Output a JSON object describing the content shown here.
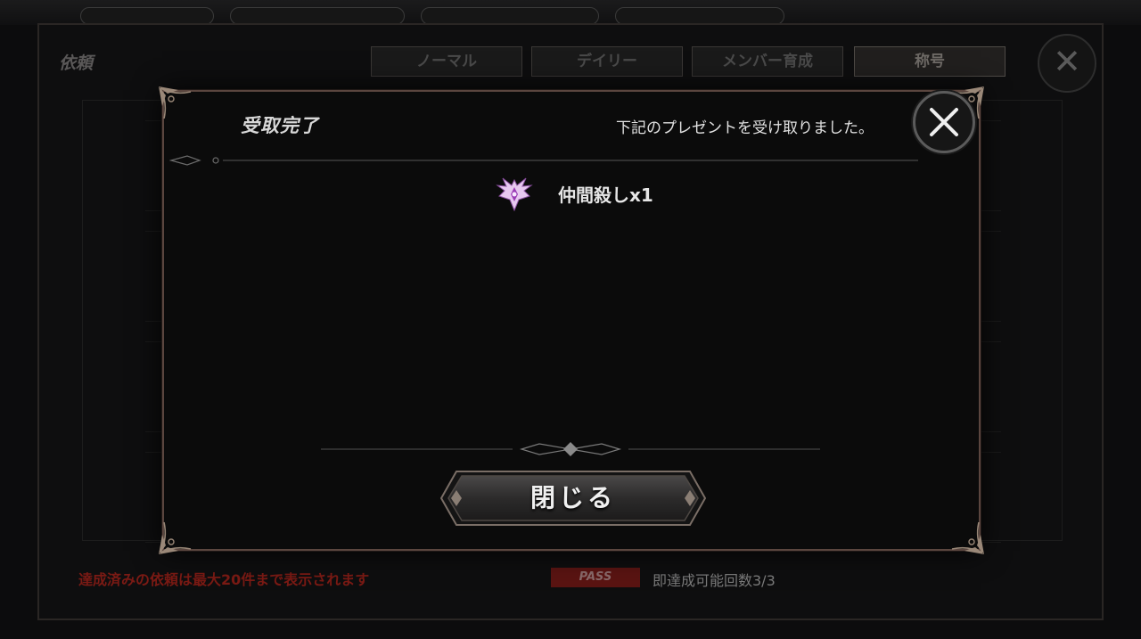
{
  "background": {
    "title": "依頼",
    "tabs": [
      {
        "label": "ノーマル",
        "active": false
      },
      {
        "label": "デイリー",
        "active": false
      },
      {
        "label": "メンバー育成",
        "active": false
      },
      {
        "label": "称号",
        "active": true
      }
    ],
    "warning": "達成済みの依頼は最大20件まで表示されます",
    "pass_badge": "PASS",
    "pass_text": "即達成可能回数3/3"
  },
  "dialog": {
    "title": "受取完了",
    "subtitle": "下記のプレゼントを受け取りました。",
    "reward": {
      "icon": "winged-emblem-icon",
      "label": "仲間殺しx1"
    },
    "close_button": "閉じる"
  },
  "colors": {
    "frame": "#5b463f",
    "corner_ornament": "#9a8878",
    "warning": "#7a1a14",
    "emblem": "#d8a6e8"
  }
}
